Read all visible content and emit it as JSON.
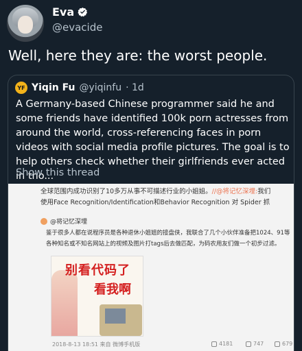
{
  "author": {
    "display_name": "Eva",
    "handle": "@evacide",
    "verified_icon": "verified-badge-icon"
  },
  "tweet": {
    "text": "Well, here they are: the worst people."
  },
  "quoted": {
    "avatar_initials": "YF",
    "name": "Yiqin Fu",
    "handle": "@yiqinfu",
    "time": "· 1d",
    "text": "A Germany-based Chinese programmer said he and some friends have identified 100k porn actresses from around the world, cross-referencing faces in porn videos with social media profile pictures. The goal is to help others check whether their girlfriends ever acted in tho...",
    "show_thread": "Show this thread"
  },
  "weibo": {
    "line1_main": "全球范围内成功识别了10多万从事不可描述行业的小姐姐。",
    "line1_link": "//@将记忆深埋:",
    "line1_end": "我们",
    "line2": "使用Face Recognition/Identification和Behavior Recognition 对 Spider 抓",
    "user": "@将记忆深埋",
    "body": "鉴于很多人都在说程序员是各种退休小姐姐的接盘侠，我联合了几个小伙伴准备把1024、91等各种知名或不知名网站上的视频及图片打tags后去做匹配，为码农用友们做一个初步过滤。",
    "comic_line1": "别看代码了",
    "comic_line2": "看我啊",
    "timestamp": "2018-8-13 18:51 来自 微博手机版",
    "reposts": "4181",
    "comments": "747",
    "likes": "679"
  },
  "colors": {
    "background": "#15202b",
    "muted_text": "#b6c2cc",
    "border": "#38444d",
    "verified": "#ffffff"
  }
}
